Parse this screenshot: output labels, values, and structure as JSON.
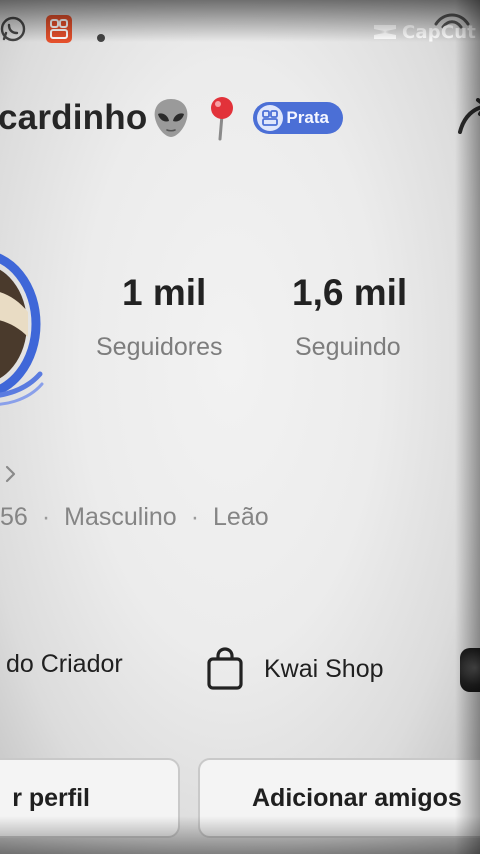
{
  "watermark": {
    "label": "CapCut"
  },
  "profile": {
    "username_partial": "cardinho",
    "badge_label": "Prata",
    "icons": [
      "alien-emoji-icon",
      "round-pushpin-icon",
      "badge-icon",
      "share-icon"
    ]
  },
  "stats": {
    "followers": {
      "value": "1 mil",
      "label": "Seguidores"
    },
    "following": {
      "value": "1,6 mil",
      "label": "Seguindo"
    }
  },
  "info": {
    "id_partial": "56",
    "separator": "·",
    "gender": "Masculino",
    "sign": "Leão"
  },
  "links": {
    "creator_partial": "do Criador",
    "shop": "Kwai Shop"
  },
  "buttons": {
    "edit_partial": "r perfil",
    "add_friends_partial": "Adicionar amigos"
  },
  "colors": {
    "badge_bg": "#4b6fd6",
    "text_primary": "#222222",
    "text_secondary": "#7d7d7d"
  }
}
